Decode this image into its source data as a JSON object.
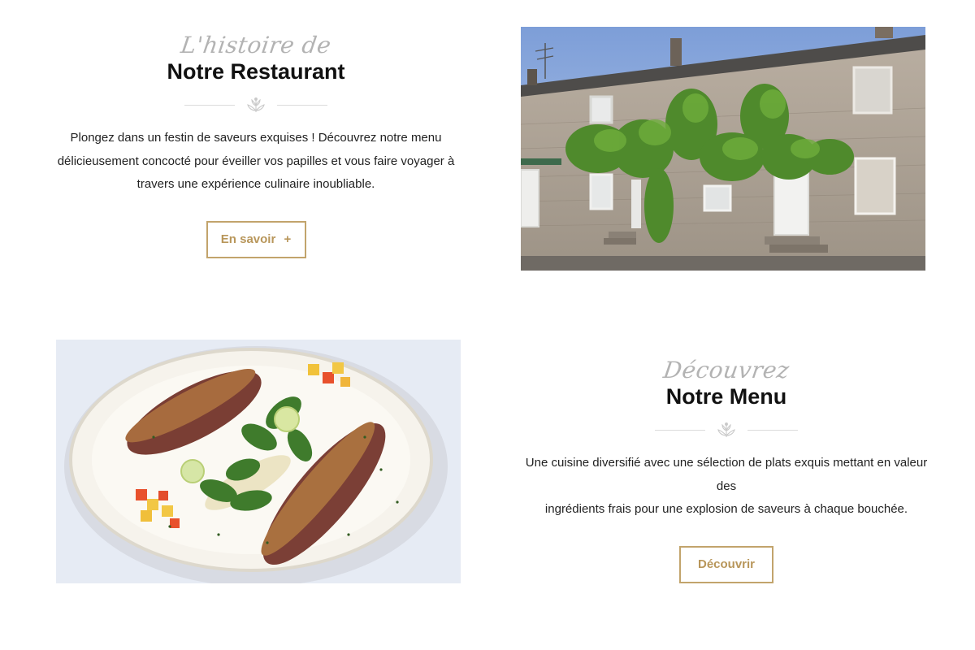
{
  "sections": [
    {
      "script_title": "L'histoire de",
      "title": "Notre Restaurant",
      "paragraph_lines": [
        "Plongez dans un festin de saveurs exquises ! Découvrez notre menu",
        "délicieusement concocté pour éveiller vos papilles et vous faire voyager à",
        "travers une expérience culinaire inoubliable."
      ],
      "button_label": "En savoir",
      "button_icon": "+",
      "image": "restaurant-facade-photo"
    },
    {
      "script_title": "Découvrez",
      "title": "Notre Menu",
      "paragraph_lines": [
        "Une cuisine diversifié avec une sélection de plats exquis mettant en valeur des",
        "ingrédients frais pour une explosion de saveurs à chaque bouchée."
      ],
      "button_label": "Découvrir",
      "image": "plated-dish-photo"
    }
  ],
  "colors": {
    "accent_gold": "#c2a46c",
    "script_grey": "#b3b3b3",
    "title_black": "#111111"
  }
}
